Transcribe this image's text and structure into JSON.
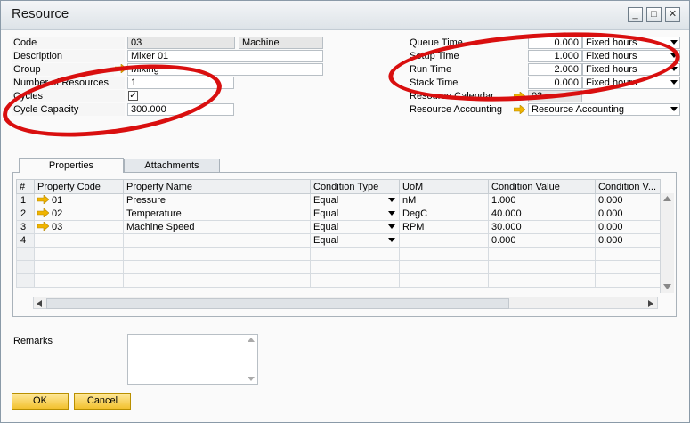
{
  "window": {
    "title": "Resource"
  },
  "title_buttons": {
    "minimize": "_",
    "maximize": "□",
    "close": "✕"
  },
  "left_form": {
    "code_label": "Code",
    "code_value": "03",
    "code_type": "Machine",
    "description_label": "Description",
    "description_value": "Mixer 01",
    "group_label": "Group",
    "group_value": "Mixing",
    "num_resources_label": "Number of Resources",
    "num_resources_value": "1",
    "cycles_label": "Cycles",
    "cycles_checked": "✓",
    "cycle_capacity_label": "Cycle Capacity",
    "cycle_capacity_value": "300.000"
  },
  "right_form": {
    "queue_time_label": "Queue Time",
    "queue_time_value": "0.000",
    "queue_time_unit": "Fixed hours",
    "setup_time_label": "Setup Time",
    "setup_time_value": "1.000",
    "setup_time_unit": "Fixed hours",
    "run_time_label": "Run Time",
    "run_time_value": "2.000",
    "run_time_unit": "Fixed hours",
    "stack_time_label": "Stack Time",
    "stack_time_value": "0.000",
    "stack_time_unit": "Fixed hours",
    "calendar_label": "Resource Calendar",
    "calendar_value": "03",
    "accounting_label": "Resource Accounting",
    "accounting_value": "Resource Accounting"
  },
  "tabs": {
    "properties": "Properties",
    "attachments": "Attachments"
  },
  "grid": {
    "headers": [
      "#",
      "Property Code",
      "Property Name",
      "Condition Type",
      "UoM",
      "Condition Value",
      "Condition V..."
    ],
    "rows": [
      {
        "num": "1",
        "code": "01",
        "name": "Pressure",
        "cond_type": "Equal",
        "uom": "nM",
        "cond_value": "1.000",
        "cond_v2": "0.000"
      },
      {
        "num": "2",
        "code": "02",
        "name": "Temperature",
        "cond_type": "Equal",
        "uom": "DegC",
        "cond_value": "40.000",
        "cond_v2": "0.000"
      },
      {
        "num": "3",
        "code": "03",
        "name": "Machine Speed",
        "cond_type": "Equal",
        "uom": "RPM",
        "cond_value": "30.000",
        "cond_v2": "0.000"
      },
      {
        "num": "4",
        "code": "",
        "name": "",
        "cond_type": "Equal",
        "uom": "",
        "cond_value": "0.000",
        "cond_v2": "0.000"
      }
    ]
  },
  "remarks": {
    "label": "Remarks",
    "value": ""
  },
  "footer": {
    "ok_label": "OK",
    "cancel_label": "Cancel"
  },
  "colors": {
    "accent_button": "#f2c12e",
    "highlight_ring": "#d90f0f",
    "link_arrow": "#f0b400"
  }
}
